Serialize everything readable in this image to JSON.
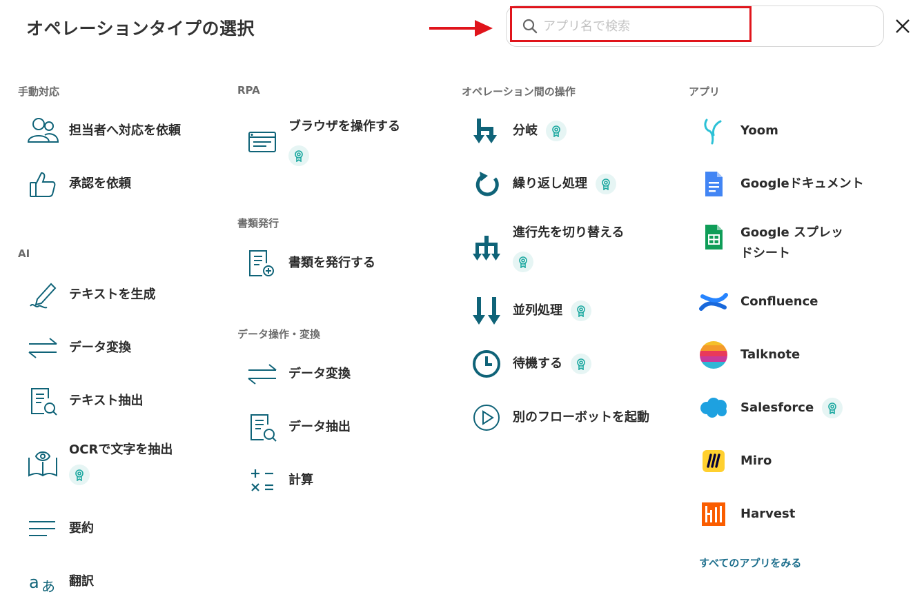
{
  "header": {
    "title": "オペレーションタイプの選択",
    "search_placeholder": "アプリ名で検索",
    "search_value": ""
  },
  "colors": {
    "accent": "#0f6378",
    "highlight_red": "#e0141b",
    "badge_bg": "#e6f5f4",
    "badge_fg": "#1ba8a0"
  },
  "sections": {
    "manual": {
      "label": "手動対応",
      "items": [
        {
          "label": "担当者へ対応を依頼",
          "icon": "people-icon"
        },
        {
          "label": "承認を依頼",
          "icon": "thumbs-up-icon"
        }
      ]
    },
    "ai": {
      "label": "AI",
      "items": [
        {
          "label": "テキストを生成",
          "icon": "pen-icon"
        },
        {
          "label": "データ変換",
          "icon": "swap-arrows-icon"
        },
        {
          "label": "テキスト抽出",
          "icon": "doc-search-icon"
        },
        {
          "label": "OCRで文字を抽出",
          "icon": "book-eye-icon",
          "badge": true
        },
        {
          "label": "要約",
          "icon": "lines-icon"
        },
        {
          "label": "翻訳",
          "icon": "translate-icon"
        }
      ]
    },
    "rpa": {
      "label": "RPA",
      "items": [
        {
          "label": "ブラウザを操作する",
          "icon": "browser-icon",
          "badge": true
        }
      ]
    },
    "docs": {
      "label": "書類発行",
      "items": [
        {
          "label": "書類を発行する",
          "icon": "doc-plus-icon"
        }
      ]
    },
    "data_ops": {
      "label": "データ操作・変換",
      "items": [
        {
          "label": "データ変換",
          "icon": "swap-arrows-icon"
        },
        {
          "label": "データ抽出",
          "icon": "doc-search-icon"
        },
        {
          "label": "計算",
          "icon": "calc-icon"
        }
      ]
    },
    "ops": {
      "label": "オペレーション間の操作",
      "items": [
        {
          "label": "分岐",
          "icon": "branch-icon",
          "badge": true
        },
        {
          "label": "繰り返し処理",
          "icon": "loop-icon",
          "badge": true
        },
        {
          "label": "進行先を切り替える",
          "icon": "switch-icon",
          "badge": true
        },
        {
          "label": "並列処理",
          "icon": "parallel-icon",
          "badge": true
        },
        {
          "label": "待機する",
          "icon": "clock-icon",
          "badge": true
        },
        {
          "label": "別のフローボットを起動",
          "icon": "play-icon"
        }
      ]
    },
    "apps": {
      "label": "アプリ",
      "items": [
        {
          "label": "Yoom",
          "icon": "yoom-icon"
        },
        {
          "label": "Googleドキュメント",
          "icon": "google-docs-icon"
        },
        {
          "label": "Google スプレッドシート",
          "icon": "google-sheets-icon"
        },
        {
          "label": "Confluence",
          "icon": "confluence-icon"
        },
        {
          "label": "Talknote",
          "icon": "talknote-icon"
        },
        {
          "label": "Salesforce",
          "icon": "salesforce-icon",
          "badge": true
        },
        {
          "label": "Miro",
          "icon": "miro-icon"
        },
        {
          "label": "Harvest",
          "icon": "harvest-icon"
        }
      ],
      "all_link": "すべてのアプリをみる"
    }
  }
}
